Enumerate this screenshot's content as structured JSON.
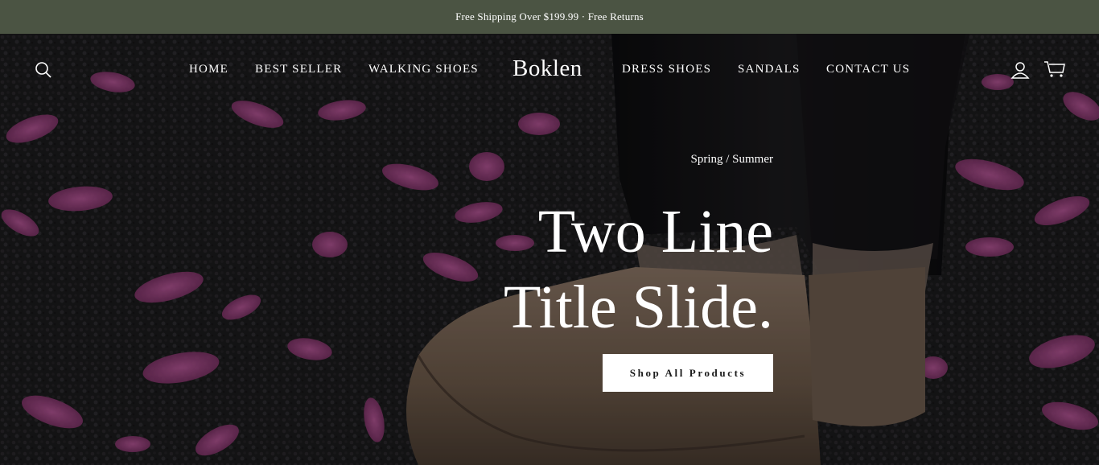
{
  "announcement": {
    "text": "Free Shipping Over $199.99 · Free Returns"
  },
  "header": {
    "logo": "Boklen",
    "nav_left": [
      {
        "label": "HOME"
      },
      {
        "label": "BEST SELLER"
      },
      {
        "label": "WALKING SHOES"
      }
    ],
    "nav_right": [
      {
        "label": "DRESS SHOES"
      },
      {
        "label": "SANDALS"
      },
      {
        "label": "CONTACT US"
      }
    ],
    "icons": {
      "search": "search-icon",
      "account": "user-icon",
      "cart": "cart-icon"
    }
  },
  "hero": {
    "subheading": "Spring / Summer",
    "title_line1": "Two Line",
    "title_line2": "Title Slide.",
    "cta_label": "Shop All Products"
  },
  "colors": {
    "announcement_bg": "#4b5443",
    "text_light": "#ffffff",
    "button_bg": "#ffffff",
    "button_text": "#1a1a1a"
  }
}
